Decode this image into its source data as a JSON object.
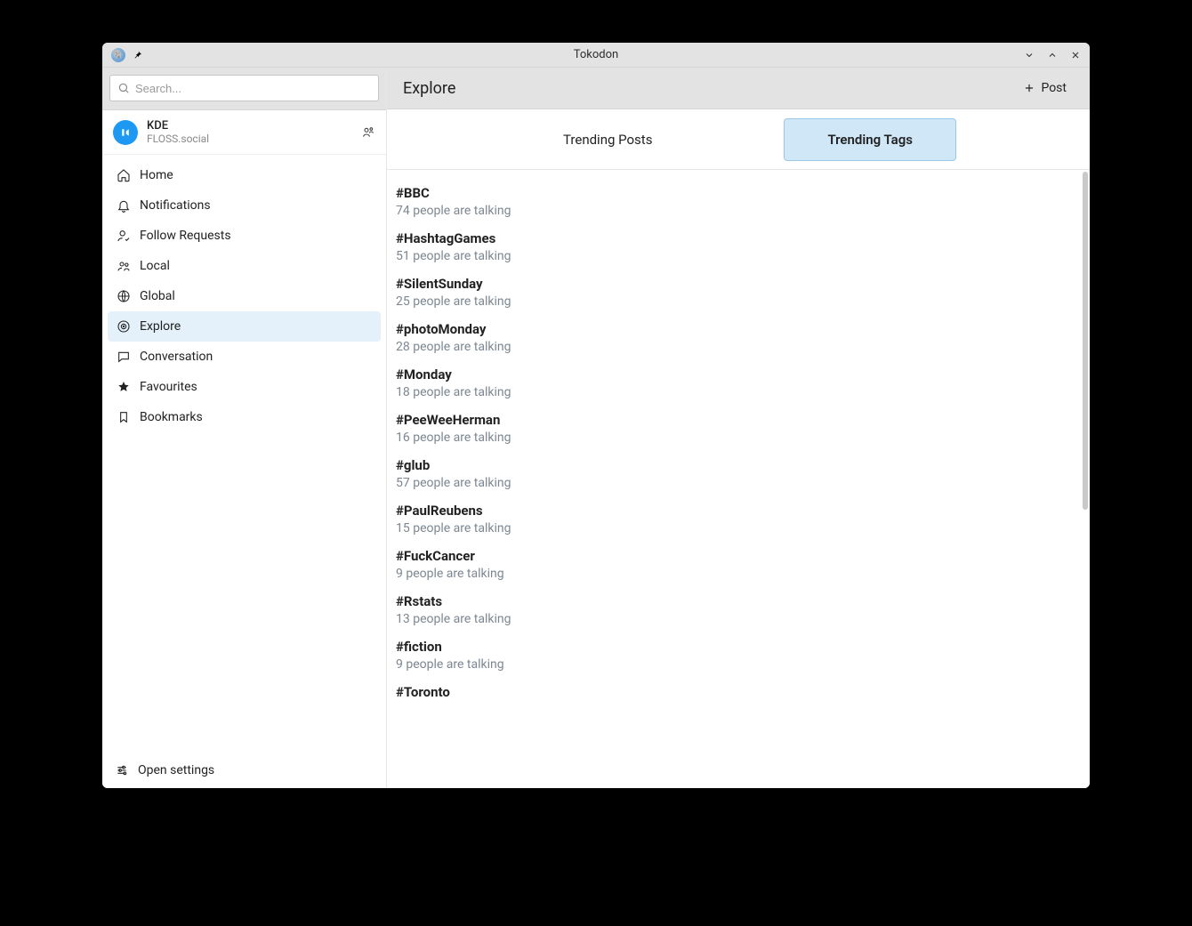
{
  "app": {
    "title": "Tokodon"
  },
  "search": {
    "placeholder": "Search..."
  },
  "account": {
    "name": "KDE",
    "server": "FLOSS.social"
  },
  "sidebar": {
    "items": [
      {
        "label": "Home"
      },
      {
        "label": "Notifications"
      },
      {
        "label": "Follow Requests"
      },
      {
        "label": "Local"
      },
      {
        "label": "Global"
      },
      {
        "label": "Explore"
      },
      {
        "label": "Conversation"
      },
      {
        "label": "Favourites"
      },
      {
        "label": "Bookmarks"
      }
    ],
    "footer": {
      "label": "Open settings"
    }
  },
  "header": {
    "page_title": "Explore",
    "post_label": "Post"
  },
  "tabs": {
    "trending_posts": "Trending Posts",
    "trending_tags": "Trending Tags"
  },
  "tags": [
    {
      "name": "#BBC",
      "sub": "74 people are talking"
    },
    {
      "name": "#HashtagGames",
      "sub": "51 people are talking"
    },
    {
      "name": "#SilentSunday",
      "sub": "25 people are talking"
    },
    {
      "name": "#photoMonday",
      "sub": "28 people are talking"
    },
    {
      "name": "#Monday",
      "sub": "18 people are talking"
    },
    {
      "name": "#PeeWeeHerman",
      "sub": "16 people are talking"
    },
    {
      "name": "#glub",
      "sub": "57 people are talking"
    },
    {
      "name": "#PaulReubens",
      "sub": "15 people are talking"
    },
    {
      "name": "#FuckCancer",
      "sub": "9 people are talking"
    },
    {
      "name": "#Rstats",
      "sub": "13 people are talking"
    },
    {
      "name": "#fiction",
      "sub": "9 people are talking"
    },
    {
      "name": "#Toronto",
      "sub": ""
    }
  ]
}
